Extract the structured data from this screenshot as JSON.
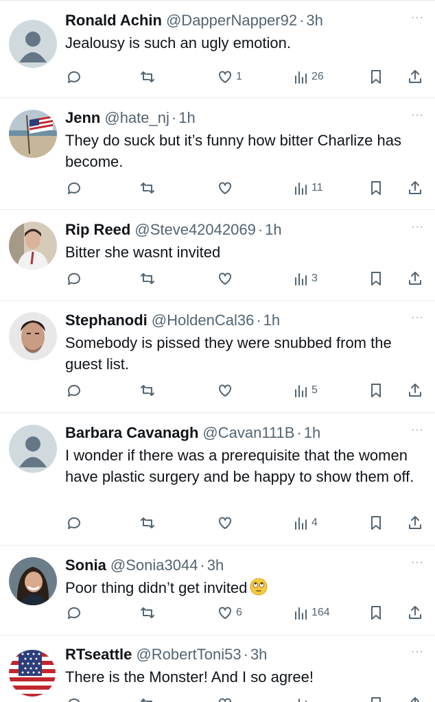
{
  "tweets": [
    {
      "name": "Ronald Achin",
      "handle": "@DapperNapper92",
      "time": "3h",
      "text": "Jealousy is such an ugly emotion.",
      "likes": "1",
      "views": "26",
      "avatar": "default"
    },
    {
      "name": "Jenn",
      "handle": "@hate_nj",
      "time": "1h",
      "text": "They do suck but it’s funny how bitter Charlize has become.",
      "likes": "",
      "views": "11",
      "avatar": "flag-beach"
    },
    {
      "name": "Rip Reed",
      "handle": "@Steve42042069",
      "time": "1h",
      "text": "Bitter she wasnt invited",
      "likes": "",
      "views": "3",
      "avatar": "photo-man-shirt"
    },
    {
      "name": "Stephanodi",
      "handle": "@HoldenCal36",
      "time": "1h",
      "text": "Somebody is pissed they were snubbed from the guest list.",
      "likes": "",
      "views": "5",
      "avatar": "photo-man-face"
    },
    {
      "name": "Barbara Cavanagh",
      "handle": "@Cavan111B",
      "time": "1h",
      "text": "I wonder if there was a prerequisite that the women have plastic surgery and be happy to show them off.",
      "likes": "",
      "views": "4",
      "avatar": "default"
    },
    {
      "name": "Sonia",
      "handle": "@Sonia3044",
      "time": "3h",
      "text": "Poor thing didn’t get invited",
      "likes": "6",
      "views": "164",
      "avatar": "photo-woman",
      "emoji": "face-with-rolling-eyes"
    },
    {
      "name": "RTseattle",
      "handle": "@RobertToni53",
      "time": "3h",
      "text": "There is the Monster!  And I so agree!",
      "likes": "",
      "views": "",
      "avatar": "us-flag"
    }
  ],
  "dot_separator": "·",
  "more_label": "···",
  "icons": [
    "reply-icon",
    "retweet-icon",
    "like-icon",
    "views-icon",
    "bookmark-icon",
    "share-icon"
  ],
  "colors": {
    "text": "#0f1419",
    "secondary": "#536471",
    "divider": "#e6e9eb"
  }
}
